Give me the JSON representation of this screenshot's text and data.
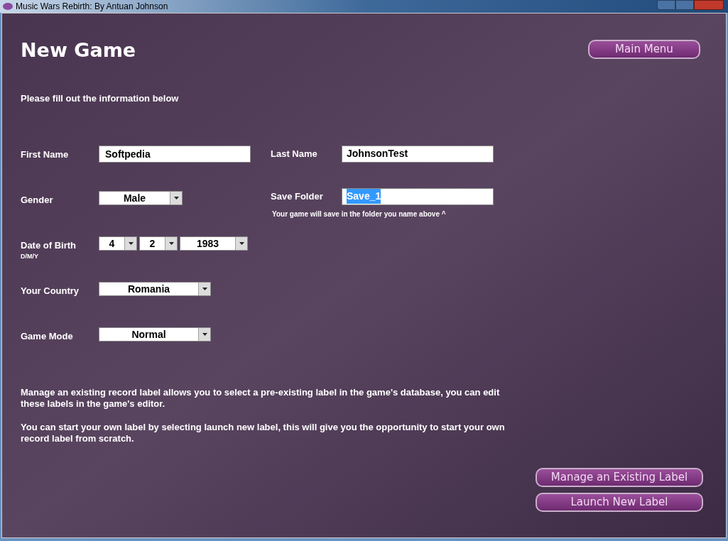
{
  "window": {
    "title": "Music Wars Rebirth: By Antuan Johnson"
  },
  "heading": "New Game",
  "main_menu_button": "Main Menu",
  "intro": "Please fill out the information below",
  "left_fields": [
    {
      "kind": "text",
      "label": "First Name",
      "value": "Softpedia"
    },
    {
      "kind": "select",
      "label": "Gender",
      "options": [
        {
          "value": "Male"
        }
      ]
    },
    {
      "kind": "select",
      "label": "Date of Birth",
      "sublabel": "D/M/Y",
      "options": [
        {
          "value": "4"
        },
        {
          "value": "2"
        },
        {
          "value": "1983"
        }
      ]
    },
    {
      "kind": "select",
      "label": "Your Country",
      "options": [
        {
          "value": "Romania"
        }
      ]
    },
    {
      "kind": "select",
      "label": "Game Mode",
      "options": [
        {
          "value": "Normal"
        }
      ]
    }
  ],
  "right_fields": [
    {
      "label": "Last Name",
      "value": "JohnsonTest",
      "highlighted": false
    },
    {
      "label": "Save Folder",
      "value": "Save_1",
      "highlighted": true,
      "note": "Your game will save in the folder you name above ^"
    }
  ],
  "paragraphs": [
    "Manage an existing record label allows you to select a pre-existing label in the game's database, you can edit these labels in the game's editor.",
    "You can start your own label by selecting launch new label, this will give you the opportunity to start your own record label from scratch."
  ],
  "action_buttons": [
    "Manage an Existing Label",
    "Launch New Label"
  ]
}
